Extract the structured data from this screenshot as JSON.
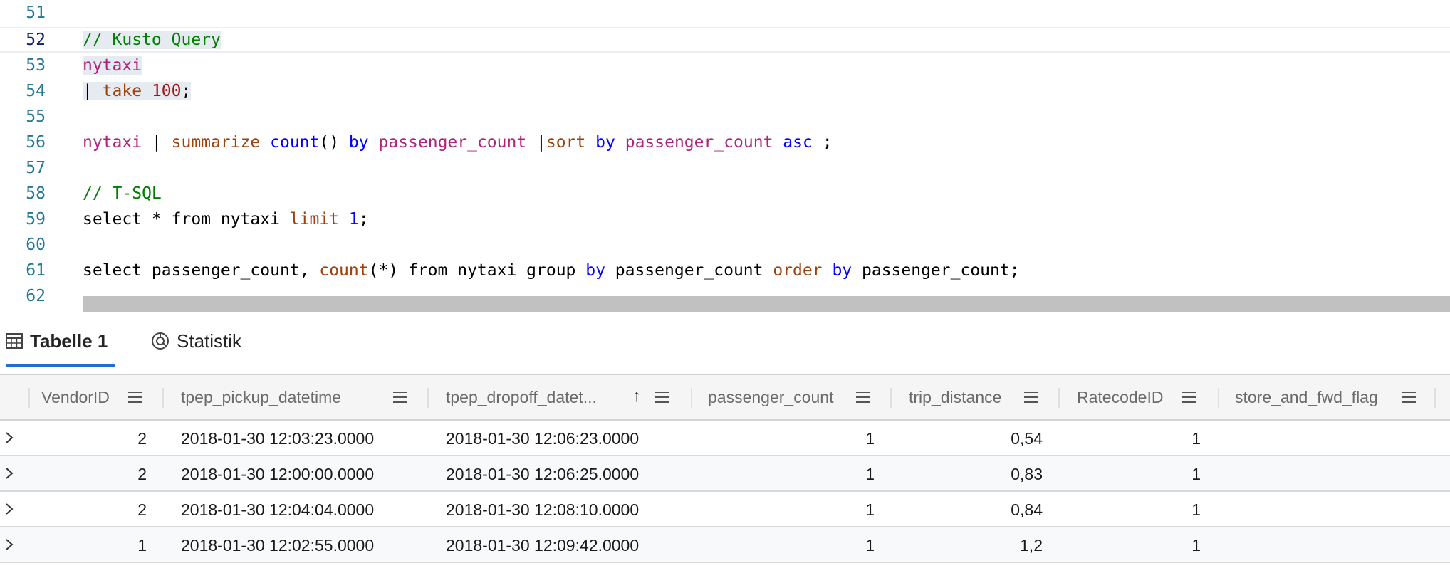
{
  "editor": {
    "lines": [
      {
        "n": "51",
        "tokens": []
      },
      {
        "n": "52",
        "tokens": [
          {
            "t": "// Kusto Query",
            "c": "t-comment",
            "hl": true
          }
        ]
      },
      {
        "n": "53",
        "tokens": [
          {
            "t": "nytaxi",
            "c": "t-table",
            "hl": true
          }
        ]
      },
      {
        "n": "54",
        "tokens": [
          {
            "t": "| ",
            "c": "t-plain",
            "hl": true
          },
          {
            "t": "take",
            "c": "t-op",
            "hl": true
          },
          {
            "t": " ",
            "c": "t-plain",
            "hl": true
          },
          {
            "t": "100",
            "c": "t-num",
            "hl": true
          },
          {
            "t": ";",
            "c": "t-plain",
            "hl": true
          }
        ]
      },
      {
        "n": "55",
        "tokens": []
      },
      {
        "n": "56",
        "tokens": [
          {
            "t": "nytaxi",
            "c": "t-table"
          },
          {
            "t": " | ",
            "c": "t-plain"
          },
          {
            "t": "summarize",
            "c": "t-op"
          },
          {
            "t": " ",
            "c": "t-plain"
          },
          {
            "t": "count",
            "c": "t-kw"
          },
          {
            "t": "() ",
            "c": "t-plain"
          },
          {
            "t": "by",
            "c": "t-kw"
          },
          {
            "t": " ",
            "c": "t-plain"
          },
          {
            "t": "passenger_count",
            "c": "t-table"
          },
          {
            "t": " |",
            "c": "t-plain"
          },
          {
            "t": "sort",
            "c": "t-op"
          },
          {
            "t": " ",
            "c": "t-plain"
          },
          {
            "t": "by",
            "c": "t-kw"
          },
          {
            "t": " ",
            "c": "t-plain"
          },
          {
            "t": "passenger_count",
            "c": "t-table"
          },
          {
            "t": " ",
            "c": "t-plain"
          },
          {
            "t": "asc",
            "c": "t-kw"
          },
          {
            "t": " ;",
            "c": "t-plain"
          }
        ]
      },
      {
        "n": "57",
        "tokens": []
      },
      {
        "n": "58",
        "tokens": [
          {
            "t": "// T-SQL",
            "c": "t-comment"
          }
        ]
      },
      {
        "n": "59",
        "tokens": [
          {
            "t": "select * from nytaxi ",
            "c": "t-plain"
          },
          {
            "t": "limit",
            "c": "t-op"
          },
          {
            "t": " ",
            "c": "t-plain"
          },
          {
            "t": "1",
            "c": "t-kw"
          },
          {
            "t": ";",
            "c": "t-plain"
          }
        ]
      },
      {
        "n": "60",
        "tokens": []
      },
      {
        "n": "61",
        "tokens": [
          {
            "t": "select passenger_count, ",
            "c": "t-plain"
          },
          {
            "t": "count",
            "c": "t-op"
          },
          {
            "t": "(*) from nytaxi group ",
            "c": "t-plain"
          },
          {
            "t": "by",
            "c": "t-kw"
          },
          {
            "t": " passenger_count ",
            "c": "t-plain"
          },
          {
            "t": "order",
            "c": "t-op"
          },
          {
            "t": " ",
            "c": "t-plain"
          },
          {
            "t": "by",
            "c": "t-kw"
          },
          {
            "t": " passenger_count;",
            "c": "t-plain"
          }
        ]
      },
      {
        "n": "62",
        "tokens": []
      }
    ],
    "active_line": "52"
  },
  "tabs": [
    {
      "label": "Tabelle 1",
      "icon": "table-icon",
      "active": true
    },
    {
      "label": "Statistik",
      "icon": "statistics-icon",
      "active": false
    }
  ],
  "grid": {
    "columns": [
      {
        "label": "VendorID"
      },
      {
        "label": "tpep_pickup_datetime"
      },
      {
        "label": "tpep_dropoff_datet...",
        "sorted": "ascending"
      },
      {
        "label": "passenger_count"
      },
      {
        "label": "trip_distance"
      },
      {
        "label": "RatecodeID"
      },
      {
        "label": "store_and_fwd_flag"
      }
    ],
    "rows": [
      [
        "2",
        "2018-01-30 12:03:23.0000",
        "2018-01-30 12:06:23.0000",
        "1",
        "0,54",
        "1",
        ""
      ],
      [
        "2",
        "2018-01-30 12:00:00.0000",
        "2018-01-30 12:06:25.0000",
        "1",
        "0,83",
        "1",
        ""
      ],
      [
        "2",
        "2018-01-30 12:04:04.0000",
        "2018-01-30 12:08:10.0000",
        "1",
        "0,84",
        "1",
        ""
      ],
      [
        "1",
        "2018-01-30 12:02:55.0000",
        "2018-01-30 12:09:42.0000",
        "1",
        "1,2",
        "1",
        ""
      ]
    ]
  }
}
